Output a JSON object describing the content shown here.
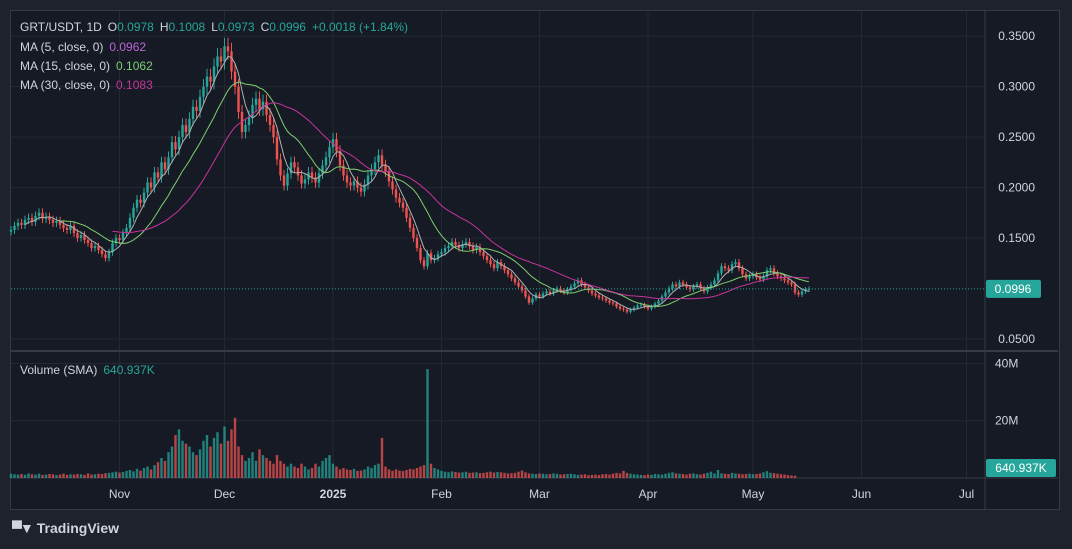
{
  "header": {
    "symbol": "GRT/USDT, 1D",
    "o_label": "O",
    "o_value": "0.0978",
    "h_label": "H",
    "h_value": "0.1008",
    "l_label": "L",
    "l_value": "0.0973",
    "c_label": "C",
    "c_value": "0.0996",
    "change": "+0.0018 (+1.84%)"
  },
  "indicators": [
    {
      "label": "MA (5, close, 0)",
      "value": "0.0962",
      "color": "#b967d8"
    },
    {
      "label": "MA (15, close, 0)",
      "value": "0.1062",
      "color": "#7ecf6e"
    },
    {
      "label": "MA (30, close, 0)",
      "value": "0.1083",
      "color": "#c7349b"
    }
  ],
  "volume_legend": {
    "label": "Volume (SMA)",
    "value": "640.937K"
  },
  "price_badge": "0.0996",
  "volume_badge": "640.937K",
  "brand": "TradingView",
  "colors": {
    "up": "#26a69a",
    "down": "#ef5350",
    "ma5": "#b0b0b0",
    "ma15": "#7ecf6e",
    "ma30": "#c7349b"
  },
  "chart_data": {
    "type": "candlestick",
    "price_axis": {
      "ticks": [
        0.35,
        0.3,
        0.25,
        0.2,
        0.15,
        0.05
      ],
      "tick_labels": [
        "0.3500",
        "0.3000",
        "0.2500",
        "0.2000",
        "0.1500",
        "0.0500"
      ],
      "range": [
        0.039,
        0.375
      ]
    },
    "volume_axis": {
      "ticks": [
        40,
        20
      ],
      "tick_labels": [
        "40M",
        "20M"
      ],
      "range": [
        0,
        44
      ],
      "unit": "M"
    },
    "x_axis": {
      "labels": [
        "Nov",
        "Dec",
        "2025",
        "Feb",
        "Mar",
        "Apr",
        "May",
        "Jun",
        "Jul"
      ],
      "label_days": [
        31,
        61,
        92,
        123,
        151,
        182,
        212,
        243,
        273
      ]
    },
    "last_price": 0.0996,
    "closes": [
      0.158,
      0.162,
      0.165,
      0.163,
      0.168,
      0.17,
      0.166,
      0.172,
      0.175,
      0.169,
      0.171,
      0.168,
      0.165,
      0.167,
      0.163,
      0.16,
      0.158,
      0.162,
      0.155,
      0.15,
      0.153,
      0.148,
      0.145,
      0.14,
      0.142,
      0.138,
      0.134,
      0.13,
      0.136,
      0.145,
      0.15,
      0.148,
      0.155,
      0.16,
      0.17,
      0.18,
      0.188,
      0.185,
      0.195,
      0.205,
      0.2,
      0.215,
      0.21,
      0.225,
      0.218,
      0.23,
      0.245,
      0.238,
      0.25,
      0.262,
      0.255,
      0.268,
      0.28,
      0.276,
      0.29,
      0.3,
      0.31,
      0.305,
      0.32,
      0.33,
      0.325,
      0.34,
      0.335,
      0.315,
      0.3,
      0.275,
      0.255,
      0.262,
      0.27,
      0.282,
      0.288,
      0.278,
      0.285,
      0.272,
      0.262,
      0.25,
      0.228,
      0.212,
      0.202,
      0.214,
      0.225,
      0.22,
      0.212,
      0.204,
      0.208,
      0.215,
      0.21,
      0.205,
      0.214,
      0.222,
      0.23,
      0.24,
      0.248,
      0.236,
      0.222,
      0.212,
      0.205,
      0.202,
      0.206,
      0.2,
      0.196,
      0.203,
      0.212,
      0.218,
      0.225,
      0.232,
      0.222,
      0.216,
      0.206,
      0.198,
      0.19,
      0.185,
      0.18,
      0.17,
      0.16,
      0.15,
      0.14,
      0.128,
      0.122,
      0.135,
      0.128,
      0.13,
      0.134,
      0.136,
      0.14,
      0.142,
      0.146,
      0.143,
      0.14,
      0.144,
      0.146,
      0.142,
      0.138,
      0.141,
      0.136,
      0.132,
      0.128,
      0.124,
      0.12,
      0.126,
      0.122,
      0.118,
      0.114,
      0.11,
      0.106,
      0.102,
      0.098,
      0.092,
      0.086,
      0.09,
      0.094,
      0.092,
      0.095,
      0.097,
      0.095,
      0.098,
      0.1,
      0.098,
      0.096,
      0.099,
      0.102,
      0.105,
      0.108,
      0.104,
      0.101,
      0.098,
      0.095,
      0.093,
      0.091,
      0.09,
      0.088,
      0.086,
      0.085,
      0.082,
      0.08,
      0.079,
      0.077,
      0.079,
      0.081,
      0.083,
      0.084,
      0.082,
      0.08,
      0.082,
      0.085,
      0.088,
      0.092,
      0.096,
      0.1,
      0.104,
      0.102,
      0.106,
      0.104,
      0.101,
      0.099,
      0.102,
      0.104,
      0.1,
      0.097,
      0.101,
      0.104,
      0.108,
      0.115,
      0.122,
      0.12,
      0.118,
      0.124,
      0.126,
      0.12,
      0.114,
      0.11,
      0.112,
      0.114,
      0.111,
      0.109,
      0.112,
      0.118,
      0.12,
      0.115,
      0.112,
      0.11,
      0.108,
      0.106,
      0.104,
      0.096,
      0.094,
      0.097,
      0.099,
      0.0996
    ],
    "volumes": [
      1.5,
      1.3,
      1.2,
      1.4,
      1.1,
      1.6,
      1.3,
      1.2,
      1.5,
      1.1,
      1.2,
      1.4,
      1.3,
      1.0,
      1.2,
      1.5,
      1.1,
      1.3,
      1.2,
      1.4,
      1.3,
      1.1,
      1.6,
      1.2,
      1.3,
      1.5,
      1.4,
      1.7,
      1.8,
      2.0,
      2.2,
      1.9,
      2.1,
      2.5,
      2.8,
      2.3,
      3.2,
      2.6,
      3.5,
      4.0,
      3.0,
      4.5,
      5.5,
      7.0,
      6.0,
      9.0,
      11.0,
      15.0,
      17.0,
      13.0,
      12.0,
      11.0,
      9.0,
      8.0,
      10.0,
      13.0,
      15.0,
      11.0,
      14.0,
      16.0,
      12.0,
      18.0,
      13.0,
      17.0,
      21.0,
      11.0,
      8.0,
      6.0,
      7.0,
      9.0,
      6.0,
      10.0,
      8.0,
      7.0,
      6.0,
      5.0,
      8.0,
      6.0,
      5.0,
      4.0,
      5.0,
      4.0,
      3.5,
      5.0,
      4.0,
      3.0,
      3.5,
      5.0,
      4.0,
      6.0,
      7.0,
      8.0,
      5.0,
      4.0,
      3.0,
      3.5,
      3.0,
      2.8,
      3.2,
      2.5,
      2.6,
      3.0,
      4.0,
      3.5,
      4.5,
      5.0,
      14.0,
      4.0,
      3.0,
      2.5,
      3.0,
      2.6,
      2.4,
      2.8,
      3.2,
      3.0,
      3.5,
      4.0,
      4.5,
      38.0,
      5.0,
      3.5,
      3.0,
      2.5,
      2.2,
      2.0,
      2.3,
      2.1,
      1.9,
      2.0,
      2.2,
      1.8,
      1.9,
      2.0,
      1.7,
      1.8,
      2.0,
      2.2,
      1.9,
      2.1,
      2.0,
      1.8,
      1.6,
      1.7,
      1.8,
      2.2,
      2.6,
      2.0,
      1.6,
      1.5,
      1.4,
      1.6,
      1.5,
      1.3,
      1.4,
      1.6,
      1.5,
      1.2,
      1.3,
      1.4,
      1.5,
      1.3,
      1.1,
      1.2,
      1.3,
      1.0,
      1.1,
      1.2,
      1.0,
      1.3,
      1.4,
      1.2,
      1.5,
      1.8,
      1.6,
      2.5,
      1.8,
      1.5,
      1.3,
      1.2,
      1.1,
      1.0,
      1.2,
      1.1,
      1.4,
      1.3,
      1.2,
      1.5,
      1.8,
      2.0,
      1.6,
      1.5,
      1.4,
      1.2,
      1.5,
      1.6,
      1.3,
      1.2,
      1.5,
      1.8,
      2.2,
      1.6,
      2.8,
      1.6,
      1.5,
      1.4,
      1.8,
      1.6,
      1.5,
      1.3,
      1.4,
      1.5,
      1.3,
      1.4,
      1.6,
      2.0,
      2.4,
      1.8,
      1.7,
      1.5,
      1.3,
      1.2,
      1.0,
      0.9,
      0.8
    ]
  }
}
